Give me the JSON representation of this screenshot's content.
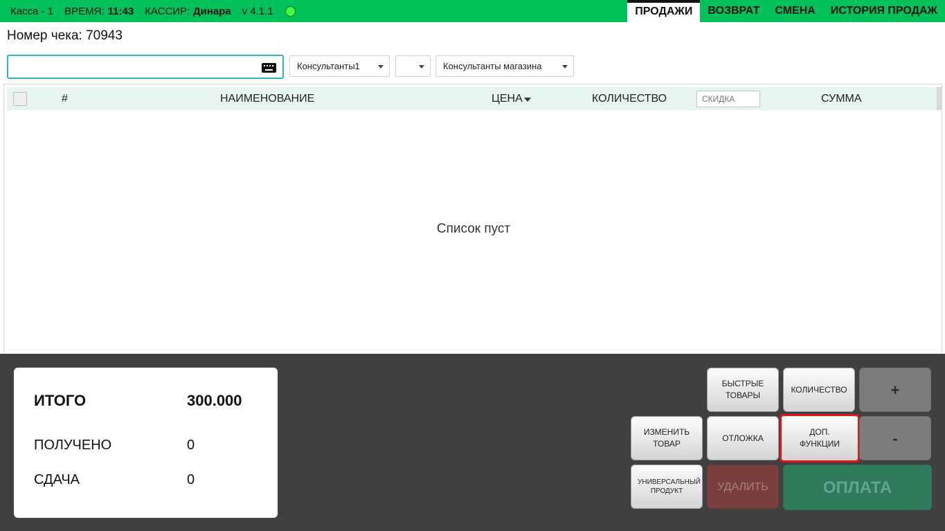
{
  "header": {
    "register": "Касса - 1",
    "time_label": "ВРЕМЯ:",
    "time_value": "11:43",
    "cashier_label": "КАССИР:",
    "cashier_name": "Динара",
    "version": "v 4.1.1",
    "status_color": "#3dff3d",
    "bar_color": "#00c15a"
  },
  "tabs": [
    {
      "label": "ПРОДАЖИ",
      "active": true
    },
    {
      "label": "ВОЗВРАТ",
      "active": false
    },
    {
      "label": "СМЕНА",
      "active": false
    },
    {
      "label": "ИСТОРИЯ ПРОДАЖ",
      "active": false
    }
  ],
  "check_number": "Номер чека: 70943",
  "search": {
    "value": "",
    "placeholder": "",
    "icon": "keyboard-icon"
  },
  "dropdowns": {
    "consultant1": "Консультанты1",
    "blank": "",
    "store_consultants": "Консультанты магазина"
  },
  "table": {
    "columns": {
      "number": "#",
      "name": "НАИМЕНОВАНИЕ",
      "price": "ЦЕНА",
      "quantity": "КОЛИЧЕСТВО",
      "discount_placeholder": "СКИДКА",
      "sum": "СУММА"
    },
    "rows": [],
    "empty_text": "Список пуст"
  },
  "totals": {
    "total_label": "ИТОГО",
    "total_value": "300.000",
    "received_label": "ПОЛУЧЕНО",
    "received_value": "0",
    "change_label": "СДАЧА",
    "change_value": "0"
  },
  "buttons": {
    "quick_products": "БЫСТРЫЕ ТОВАРЫ",
    "quantity": "КОЛИЧЕСТВО",
    "plus": "+",
    "edit_product": "ИЗМЕНИТЬ ТОВАР",
    "defer": "ОТЛОЖКА",
    "extra_functions": "ДОП. ФУНКЦИИ",
    "minus": "-",
    "universal_product": "УНИВЕРСАЛЬНЫЙ ПРОДУКТ",
    "delete": "УДАЛИТЬ",
    "pay": "ОПЛАТА"
  }
}
